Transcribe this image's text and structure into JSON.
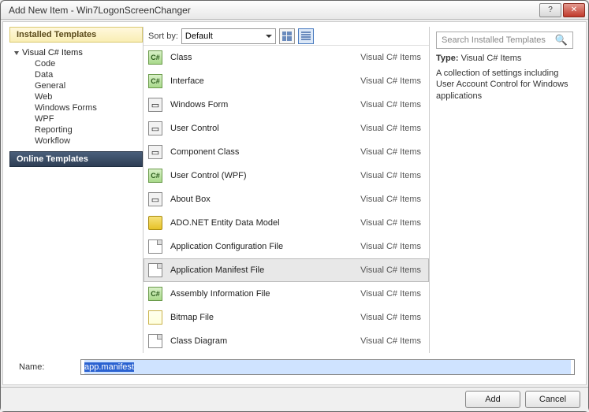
{
  "window": {
    "title": "Add New Item - Win7LogonScreenChanger"
  },
  "sidebar": {
    "installed_header": "Installed Templates",
    "online_header": "Online Templates",
    "root": "Visual C# Items",
    "children": [
      "Code",
      "Data",
      "General",
      "Web",
      "Windows Forms",
      "WPF",
      "Reporting",
      "Workflow"
    ]
  },
  "toolbar": {
    "sort_label": "Sort by:",
    "sort_value": "Default"
  },
  "items": [
    {
      "name": "Class",
      "category": "Visual C# Items",
      "icon": "cs"
    },
    {
      "name": "Interface",
      "category": "Visual C# Items",
      "icon": "cs"
    },
    {
      "name": "Windows Form",
      "category": "Visual C# Items",
      "icon": "form"
    },
    {
      "name": "User Control",
      "category": "Visual C# Items",
      "icon": "form"
    },
    {
      "name": "Component Class",
      "category": "Visual C# Items",
      "icon": "form"
    },
    {
      "name": "User Control (WPF)",
      "category": "Visual C# Items",
      "icon": "cs"
    },
    {
      "name": "About Box",
      "category": "Visual C# Items",
      "icon": "form"
    },
    {
      "name": "ADO.NET Entity Data Model",
      "category": "Visual C# Items",
      "icon": "db"
    },
    {
      "name": "Application Configuration File",
      "category": "Visual C# Items",
      "icon": "file"
    },
    {
      "name": "Application Manifest File",
      "category": "Visual C# Items",
      "icon": "file",
      "selected": true
    },
    {
      "name": "Assembly Information File",
      "category": "Visual C# Items",
      "icon": "cs"
    },
    {
      "name": "Bitmap File",
      "category": "Visual C# Items",
      "icon": "bitmap"
    },
    {
      "name": "Class Diagram",
      "category": "Visual C# Items",
      "icon": "file"
    }
  ],
  "right": {
    "search_placeholder": "Search Installed Templates",
    "type_label": "Type:",
    "type_value": "Visual C# Items",
    "description": "A collection of settings including User Account Control for Windows applications"
  },
  "namebar": {
    "label": "Name:",
    "value": "app.manifest"
  },
  "buttons": {
    "add": "Add",
    "cancel": "Cancel"
  }
}
